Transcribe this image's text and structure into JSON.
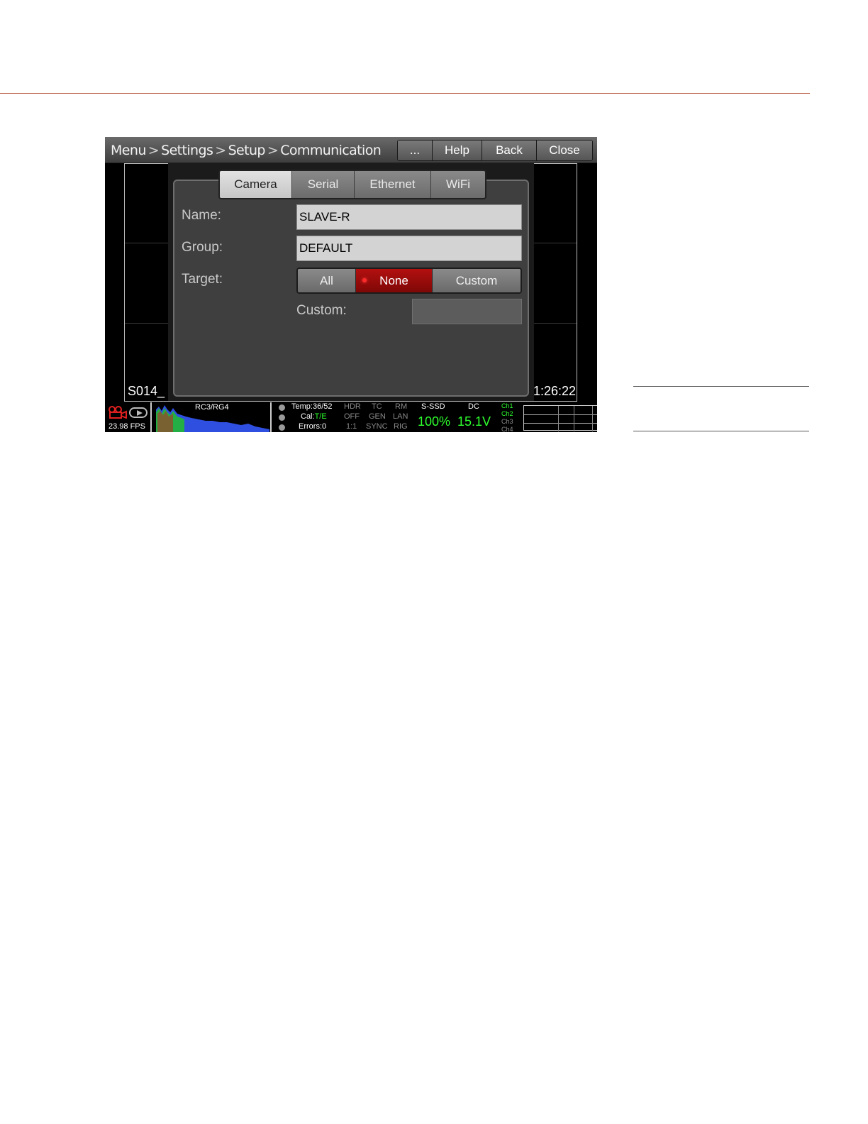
{
  "breadcrumb": {
    "items": [
      "Menu",
      "Settings",
      "Setup",
      "Communication"
    ],
    "separator": ">"
  },
  "topbar": {
    "more_label": "...",
    "help_label": "Help",
    "back_label": "Back",
    "close_label": "Close"
  },
  "tabs": [
    {
      "label": "Camera",
      "active": true
    },
    {
      "label": "Serial",
      "active": false
    },
    {
      "label": "Ethernet",
      "active": false
    },
    {
      "label": "WiFi",
      "active": false
    }
  ],
  "form": {
    "name_label": "Name:",
    "name_value": "SLAVE-R",
    "group_label": "Group:",
    "group_value": "DEFAULT",
    "target_label": "Target:",
    "target_options": [
      "All",
      "None",
      "Custom"
    ],
    "target_selected": "None",
    "custom_label": "Custom:",
    "custom_value": ""
  },
  "overlay": {
    "clip_name": "S014_",
    "timecode": "1:26:22"
  },
  "status": {
    "fps": "23.98 FPS",
    "histogram_label": "RC3/RG4",
    "temp": "Temp:36/52",
    "cal_prefix": "Cal:",
    "cal_value": "T/E",
    "errors": "Errors:0",
    "hdr": [
      "HDR",
      "OFF",
      "1:1"
    ],
    "tc": [
      "TC",
      "GEN",
      "SYNC"
    ],
    "rm": [
      "RM",
      "LAN",
      "RIG"
    ],
    "media_label": "S-SSD",
    "media_value": "100%",
    "power_label": "DC",
    "power_value": "15.1V",
    "channels": [
      "Ch1",
      "Ch2",
      "Ch3",
      "Ch4"
    ]
  },
  "colors": {
    "selected": "#9a0c0b",
    "status_green": "#2dff2d",
    "page_rule": "#b5533c"
  }
}
